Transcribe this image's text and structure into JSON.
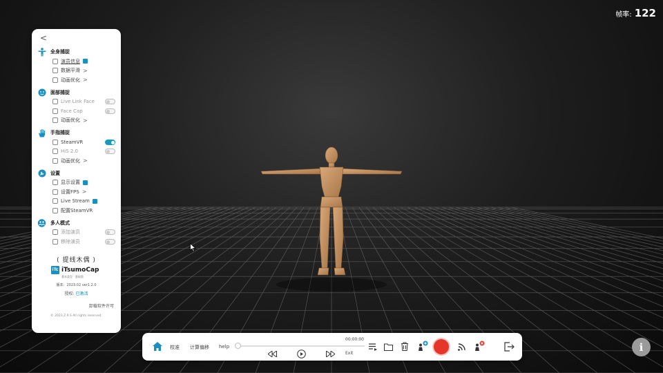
{
  "fps": {
    "label": "帧率:",
    "value": "122"
  },
  "panel": {
    "back": "<",
    "sections": [
      {
        "title": "全身捕捉",
        "icon": "person-icon",
        "items": [
          {
            "label": "演员信息",
            "extra": "badge"
          },
          {
            "label": "数据平滑",
            "extra": "chevron"
          },
          {
            "label": "动画优化",
            "extra": "chevron"
          }
        ]
      },
      {
        "title": "面部捕捉",
        "icon": "face-icon",
        "items": [
          {
            "label": "Live Link Face",
            "extra": "toggle-off"
          },
          {
            "label": "Face Cap",
            "extra": "toggle-off"
          },
          {
            "label": "动画优化",
            "extra": "chevron"
          }
        ]
      },
      {
        "title": "手指捕捉",
        "icon": "hand-icon",
        "items": [
          {
            "label": "SteamVR",
            "extra": "toggle-on"
          },
          {
            "label": "HiS 2.0",
            "extra": "toggle-off"
          },
          {
            "label": "动画优化",
            "extra": "chevron"
          }
        ]
      },
      {
        "title": "设置",
        "icon": "wrench-icon",
        "items": [
          {
            "label": "显示设置",
            "extra": "badge"
          },
          {
            "label": "设置FPS",
            "extra": "chevron"
          },
          {
            "label": "Live Stream",
            "extra": "badge"
          },
          {
            "label": "配置SteamVR",
            "extra": "none"
          }
        ]
      },
      {
        "title": "多人模式",
        "icon": "group-icon",
        "items": [
          {
            "label": "添加演员",
            "extra": "toggle-off"
          },
          {
            "label": "移除演员",
            "extra": "toggle-off"
          }
        ]
      }
    ],
    "chevron": ">",
    "brand_cn": "( 提线木偶 )",
    "logo_text": "iTc",
    "brand_name": "iTsumoCap",
    "brand_sub": "基本类型 · 基础版",
    "version": "版本：2023.02  ver1.2.0",
    "license_label": "授权: ",
    "license_status": "已激活",
    "uninstall": "卸载软件许可",
    "copyright": "© 2023 Z.R.S    All rights reserved."
  },
  "bottombar": {
    "calibrate": "校准",
    "offset": "计算偏移",
    "help": "help",
    "time": "00:00:00",
    "exit": "Exit"
  },
  "info": "i"
}
